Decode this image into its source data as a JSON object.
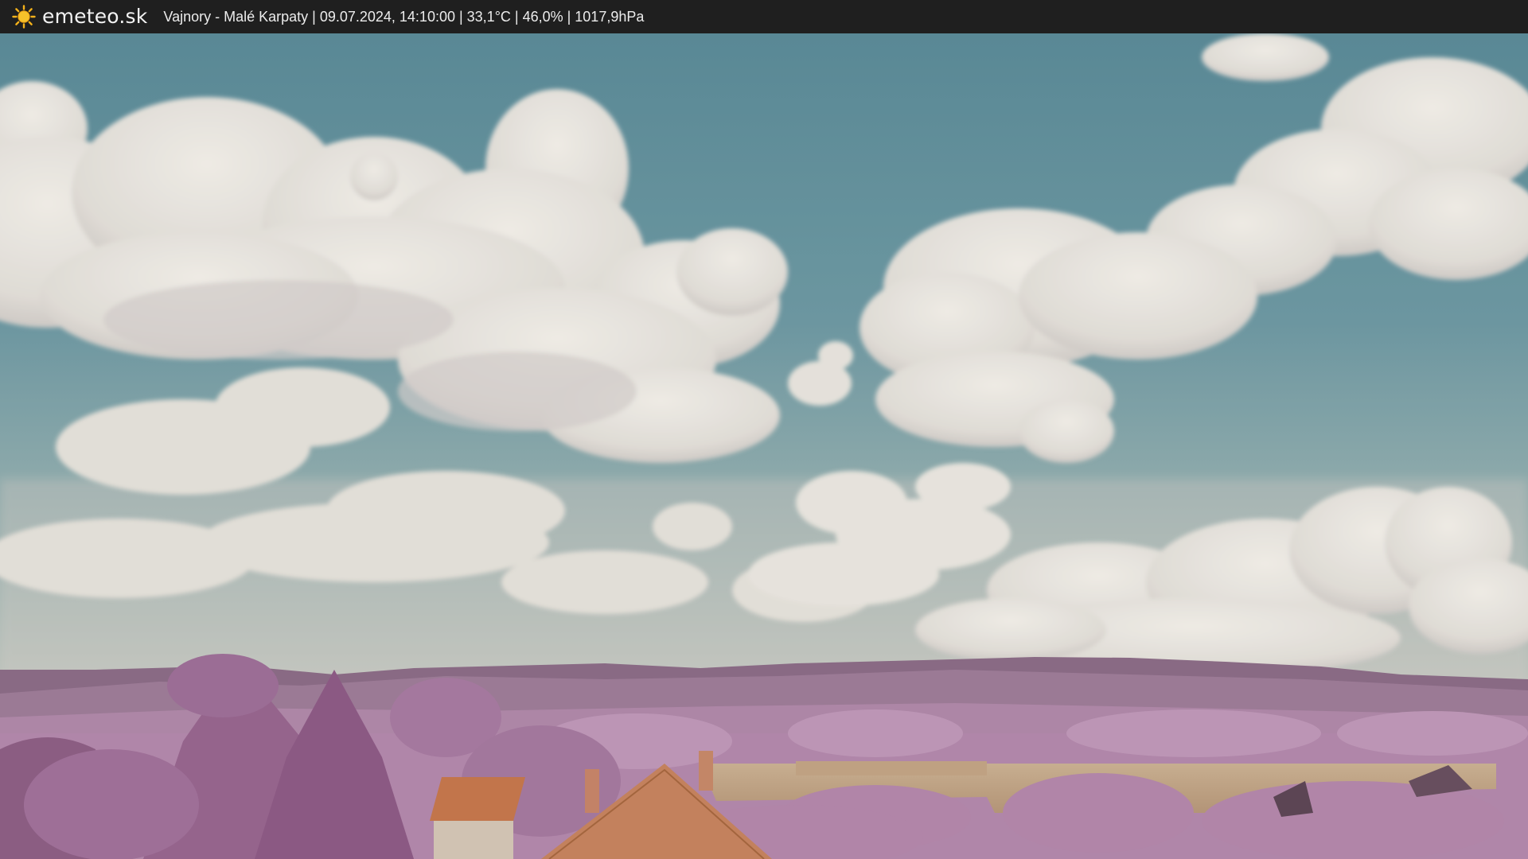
{
  "header": {
    "brand": "emeteo.sk",
    "logo_icon": "sun-icon",
    "caption": "Vajnory - Malé Karpaty | 09.07.2024, 14:10:00 | 33,1°C | 46,0% | 1017,9hPa"
  },
  "colors": {
    "bar_bg": "#1f1f1f",
    "sun": "#f5b21a",
    "sky_top": "#5f8f9c",
    "sky_low": "#c8cdc6",
    "cloud": "#f0ede6",
    "hills": "#8e6a86",
    "trees": "#b88bb0",
    "field": "#c9ae8c",
    "roof": "#d07a4e"
  },
  "scene": {
    "description_icon": "webcam-landscape-image"
  }
}
